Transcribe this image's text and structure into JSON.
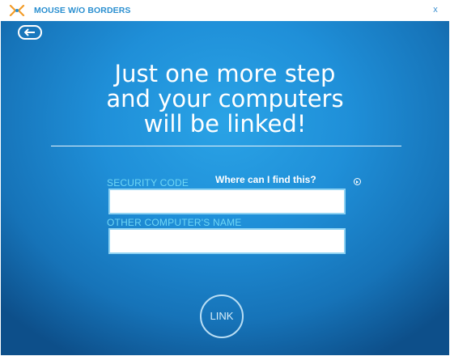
{
  "window": {
    "title": "MOUSE W/O BORDERS",
    "close_label": "x",
    "app_icon": "mouse-without-borders-icon",
    "accent_color": "#2a8fd0"
  },
  "main": {
    "back_icon": "back-arrow-icon",
    "headline_lines": [
      "Just one more step",
      "and your computers",
      "will be linked!"
    ],
    "security_code_label": "SECURITY CODE",
    "security_code_value": "",
    "help_link": "Where can I find this?",
    "help_icon": "arrow-circle-icon",
    "other_computer_label": "OTHER COMPUTER'S NAME",
    "other_computer_value": "",
    "link_button": "LINK",
    "background_color": "#1f8fd8",
    "label_color": "#6fd6f5"
  }
}
